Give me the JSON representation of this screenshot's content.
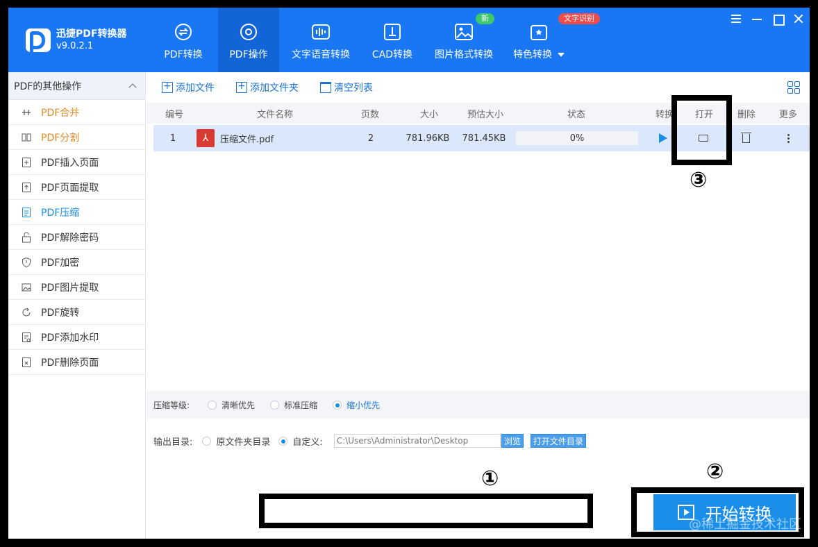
{
  "app": {
    "name": "迅捷PDF转换器",
    "version": "v9.0.2.1"
  },
  "nav": [
    {
      "label": "PDF转换",
      "icon": "pdf-convert-icon"
    },
    {
      "label": "PDF操作",
      "icon": "pdf-operate-icon"
    },
    {
      "label": "文字语音转换",
      "icon": "audio-wave-icon"
    },
    {
      "label": "CAD转换",
      "icon": "cad-icon"
    },
    {
      "label": "图片格式转换",
      "icon": "image-icon",
      "badge": "新"
    },
    {
      "label": "特色转换",
      "icon": "feature-icon",
      "badge": "文字识别"
    }
  ],
  "sidebar": {
    "header": "PDF的其他操作",
    "items": [
      {
        "label": "PDF合并"
      },
      {
        "label": "PDF分割"
      },
      {
        "label": "PDF插入页面"
      },
      {
        "label": "PDF页面提取"
      },
      {
        "label": "PDF压缩"
      },
      {
        "label": "PDF解除密码"
      },
      {
        "label": "PDF加密"
      },
      {
        "label": "PDF图片提取"
      },
      {
        "label": "PDF旋转"
      },
      {
        "label": "PDF添加水印"
      },
      {
        "label": "PDF删除页面"
      }
    ]
  },
  "toolbar": {
    "add_file": "添加文件",
    "add_folder": "添加文件夹",
    "clear_list": "清空列表"
  },
  "table": {
    "headers": [
      "编号",
      "文件名称",
      "页数",
      "大小",
      "预估大小",
      "状态",
      "转换",
      "打开",
      "删除",
      "更多"
    ],
    "rows": [
      {
        "no": "1",
        "name": "压缩文件.pdf",
        "pages": "2",
        "size": "781.96KB",
        "est": "781.45KB",
        "status": "0%"
      }
    ]
  },
  "compression": {
    "label": "压缩等级:",
    "options": [
      "清晰优先",
      "标准压缩",
      "缩小优先"
    ],
    "selected": "缩小优先"
  },
  "output": {
    "label": "输出目录:",
    "original": "原文件夹目录",
    "custom": "自定义:",
    "path": "C:\\Users\\Administrator\\Desktop",
    "browse": "浏览",
    "open_dir": "打开文件目录"
  },
  "start_button": "开始转换",
  "annotations": [
    "①",
    "②",
    "③"
  ],
  "watermark": "@稀土掘金技术社区",
  "colors": {
    "primary": "#1977f3",
    "accent": "#1a8ee8",
    "orange": "#e38a26"
  }
}
